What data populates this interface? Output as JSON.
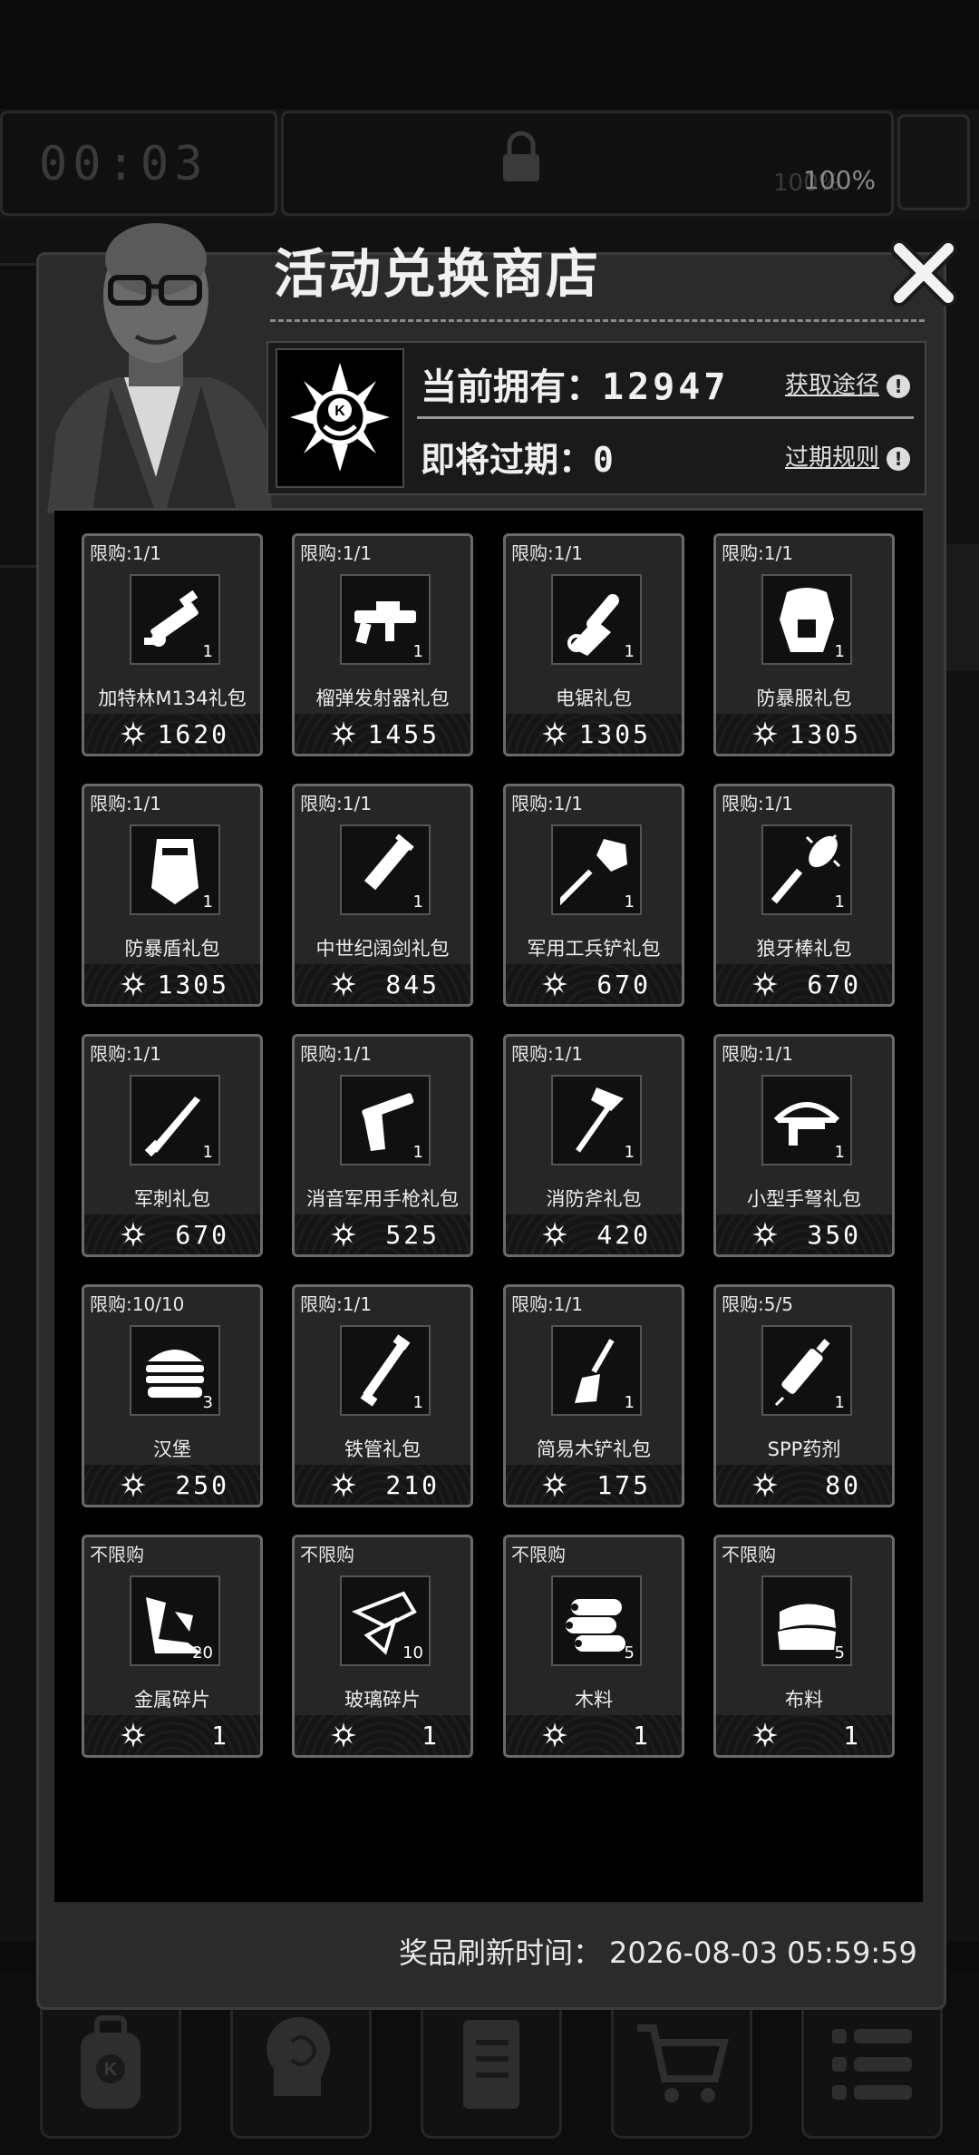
{
  "hud": {
    "timer": "00:03",
    "stat_right_pct": "100%",
    "stat_mid_pct": "100%"
  },
  "modal": {
    "title": "活动兑换商店",
    "owned_label": "当前拥有：",
    "owned_value": "12947",
    "expiring_label": "即将过期：",
    "expiring_value": "0",
    "obtain_link": "获取途径",
    "expire_rule_link": "过期规则",
    "refresh_label": "奖品刷新时间：",
    "refresh_time": "2026-08-03 05:59:59"
  },
  "items": [
    {
      "limit": "限购:1/1",
      "name": "加特林M134礼包",
      "qty": "1",
      "price": "1620",
      "icon": "minigun-icon"
    },
    {
      "limit": "限购:1/1",
      "name": "榴弹发射器礼包",
      "qty": "1",
      "price": "1455",
      "icon": "grenade-launcher-icon"
    },
    {
      "limit": "限购:1/1",
      "name": "电锯礼包",
      "qty": "1",
      "price": "1305",
      "icon": "chainsaw-icon"
    },
    {
      "limit": "限购:1/1",
      "name": "防暴服礼包",
      "qty": "1",
      "price": "1305",
      "icon": "riot-suit-icon"
    },
    {
      "limit": "限购:1/1",
      "name": "防暴盾礼包",
      "qty": "1",
      "price": "1305",
      "icon": "riot-shield-icon"
    },
    {
      "limit": "限购:1/1",
      "name": "中世纪阔剑礼包",
      "qty": "1",
      "price": "845",
      "icon": "broadsword-icon"
    },
    {
      "limit": "限购:1/1",
      "name": "军用工兵铲礼包",
      "qty": "1",
      "price": "670",
      "icon": "shovel-icon"
    },
    {
      "limit": "限购:1/1",
      "name": "狼牙棒礼包",
      "qty": "1",
      "price": "670",
      "icon": "spiked-club-icon"
    },
    {
      "limit": "限购:1/1",
      "name": "军刺礼包",
      "qty": "1",
      "price": "670",
      "icon": "bayonet-icon"
    },
    {
      "limit": "限购:1/1",
      "name": "消音军用手枪礼包",
      "qty": "1",
      "price": "525",
      "icon": "pistol-icon"
    },
    {
      "limit": "限购:1/1",
      "name": "消防斧礼包",
      "qty": "1",
      "price": "420",
      "icon": "fire-axe-icon"
    },
    {
      "limit": "限购:1/1",
      "name": "小型手弩礼包",
      "qty": "1",
      "price": "350",
      "icon": "crossbow-icon"
    },
    {
      "limit": "限购:10/10",
      "name": "汉堡",
      "qty": "3",
      "price": "250",
      "icon": "burger-icon"
    },
    {
      "limit": "限购:1/1",
      "name": "铁管礼包",
      "qty": "1",
      "price": "210",
      "icon": "iron-pipe-icon"
    },
    {
      "limit": "限购:1/1",
      "name": "简易木铲礼包",
      "qty": "1",
      "price": "175",
      "icon": "wooden-shovel-icon"
    },
    {
      "limit": "限购:5/5",
      "name": "SPP药剂",
      "qty": "1",
      "price": "80",
      "icon": "syringe-icon"
    },
    {
      "limit": "不限购",
      "name": "金属碎片",
      "qty": "20",
      "price": "1",
      "icon": "metal-scrap-icon"
    },
    {
      "limit": "不限购",
      "name": "玻璃碎片",
      "qty": "10",
      "price": "1",
      "icon": "glass-shard-icon"
    },
    {
      "limit": "不限购",
      "name": "木料",
      "qty": "5",
      "price": "1",
      "icon": "wood-logs-icon"
    },
    {
      "limit": "不限购",
      "name": "布料",
      "qty": "5",
      "price": "1",
      "icon": "cloth-icon"
    }
  ],
  "bottom_nav": [
    "backpack-icon",
    "brain-icon",
    "journal-icon",
    "cart-icon",
    "menu-icon"
  ]
}
